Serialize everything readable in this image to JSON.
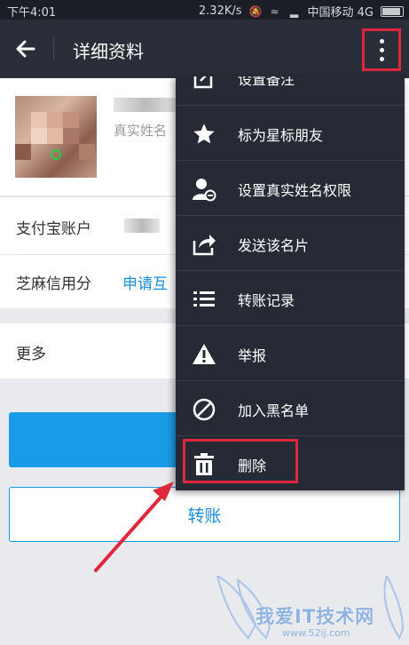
{
  "status_bar": {
    "time": "下午4:01",
    "speed": "2.32K/s",
    "carrier": "中国移动 4G"
  },
  "header": {
    "title": "详细资料"
  },
  "profile": {
    "name_partial": "",
    "real_name_label": "真实姓名"
  },
  "fields": {
    "alipay_label": "支付宝账户",
    "zhima_label": "芝麻信用分",
    "zhima_link": "申请互",
    "more_label": "更多"
  },
  "buttons": {
    "transfer": "转账"
  },
  "menu": {
    "items": [
      {
        "label": "设置备注",
        "icon": "edit-icon"
      },
      {
        "label": "标为星标朋友",
        "icon": "star-icon"
      },
      {
        "label": "设置真实姓名权限",
        "icon": "user-permission-icon"
      },
      {
        "label": "发送该名片",
        "icon": "share-icon"
      },
      {
        "label": "转账记录",
        "icon": "list-icon"
      },
      {
        "label": "举报",
        "icon": "warning-icon"
      },
      {
        "label": "加入黑名单",
        "icon": "block-icon"
      },
      {
        "label": "删除",
        "icon": "trash-icon"
      }
    ]
  },
  "watermark": {
    "text": "我爱IT技术网",
    "url": "www.52ij.com"
  },
  "colors": {
    "accent": "#1a9be8",
    "highlight": "#e0283c",
    "menu_bg": "#262a35",
    "header_bg": "#2a2e38"
  }
}
